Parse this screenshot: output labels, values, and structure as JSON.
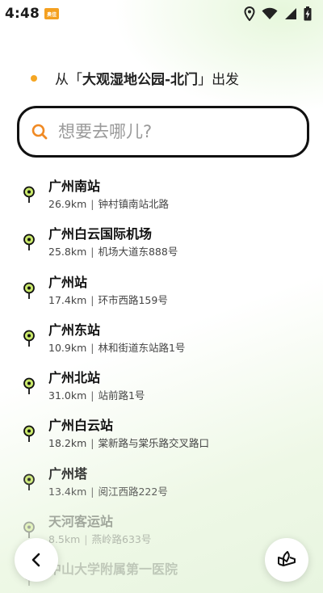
{
  "status_bar": {
    "time": "4:48",
    "app_badge": "奥佳",
    "icons": [
      "location-icon",
      "wifi-icon",
      "signal-icon",
      "battery-charging-icon"
    ]
  },
  "start": {
    "prefix": "从",
    "open_bracket": "「",
    "place": "大观湿地公园-北门",
    "close_bracket": "」",
    "suffix": "出发"
  },
  "search": {
    "placeholder": "想要去哪儿?",
    "value": ""
  },
  "results": [
    {
      "name": "广州南站",
      "distance": "26.9km",
      "address": "钟村镇南站北路"
    },
    {
      "name": "广州白云国际机场",
      "distance": "25.8km",
      "address": "机场大道东888号"
    },
    {
      "name": "广州站",
      "distance": "17.4km",
      "address": "环市西路159号"
    },
    {
      "name": "广州东站",
      "distance": "10.9km",
      "address": "林和街道东站路1号"
    },
    {
      "name": "广州北站",
      "distance": "31.0km",
      "address": "站前路1号"
    },
    {
      "name": "广州白云站",
      "distance": "18.2km",
      "address": "棠新路与棠乐路交叉路口"
    },
    {
      "name": "广州塔",
      "distance": "13.4km",
      "address": "阅江西路222号"
    },
    {
      "name": "天河客运站",
      "distance": "8.5km",
      "address": "燕岭路633号"
    },
    {
      "name": "中山大学附属第一医院",
      "distance": "",
      "address": ""
    }
  ],
  "separator": "|",
  "buttons": {
    "back_icon": "chevron-left-icon",
    "right_icon": "map-book-icon"
  },
  "colors": {
    "accent_orange": "#f5a623",
    "pin_green": "#c9e86a",
    "border_dark": "#111111"
  }
}
